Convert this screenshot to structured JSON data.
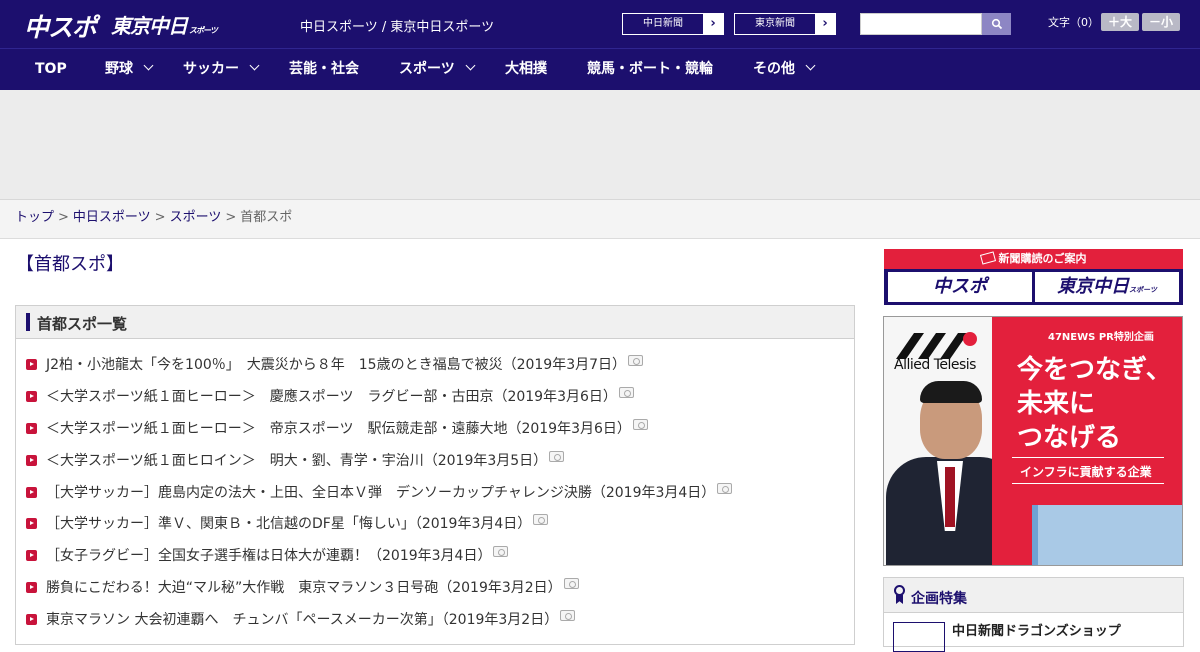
{
  "header": {
    "logo_chuspo": "中スポ",
    "logo_tokyo_main": "東京中日",
    "logo_tokyo_sub": "スポーツ",
    "site_names": "中日スポーツ / 東京中日スポーツ",
    "chunichi_link": "中日新聞",
    "tokyo_link": "東京新聞",
    "search_placeholder": "",
    "text_size_label": "文字（0）",
    "size_up": "＋大",
    "size_down": "－小"
  },
  "nav": [
    {
      "label": "TOP",
      "has_menu": false
    },
    {
      "label": "野球",
      "has_menu": true
    },
    {
      "label": "サッカー",
      "has_menu": true
    },
    {
      "label": "芸能・社会",
      "has_menu": false
    },
    {
      "label": "スポーツ",
      "has_menu": true
    },
    {
      "label": "大相撲",
      "has_menu": false
    },
    {
      "label": "競馬・ボート・競輪",
      "has_menu": false
    },
    {
      "label": "その他",
      "has_menu": true
    }
  ],
  "breadcrumb": {
    "items": [
      "トップ",
      "中日スポーツ",
      "スポーツ"
    ],
    "current": "首都スポ",
    "separator": ">"
  },
  "page_title": "【首都スポ】",
  "list": {
    "heading": "首都スポ一覧",
    "items": [
      "J2柏・小池龍太「今を100％」　大震災から８年　15歳のとき福島で被災（2019年3月7日）",
      "＜大学スポーツ紙１面ヒーロー＞　慶應スポーツ　ラグビー部・古田京（2019年3月6日）",
      "＜大学スポーツ紙１面ヒーロー＞　帝京スポーツ　駅伝競走部・遠藤大地（2019年3月6日）",
      "＜大学スポーツ紙１面ヒロイン＞　明大・劉、青学・宇治川（2019年3月5日）",
      "［大学サッカー］鹿島内定の法大・上田、全日本Ｖ弾　デンソーカップチャレンジ決勝（2019年3月4日）",
      "［大学サッカー］準Ｖ、関東Ｂ・北信越のDF星「悔しい」（2019年3月4日）",
      "［女子ラグビー］全国女子選手権は日体大が連覇！（2019年3月4日）",
      "勝負にこだわる！大迫“マル秘”大作戦　東京マラソン３日号砲（2019年3月2日）",
      "東京マラソン 大会初連覇へ　チュンバ「ペースメーカー次第」（2019年3月2日）"
    ]
  },
  "sidebar": {
    "subscribe_heading": "新聞購読のご案内",
    "subscribe_logo_1": "中スポ",
    "subscribe_logo_2_main": "東京中日",
    "subscribe_logo_2_sub": "スポーツ",
    "ad": {
      "brand": "Allied Telesis",
      "tag": "47NEWS PR特別企画",
      "lines": [
        "今をつなぎ、",
        "未来に",
        "つなげる"
      ],
      "subline": "インフラに貢献する企業",
      "accent_color": "#e3203c"
    },
    "feature_heading": "企画特集",
    "feature_item": "中日新聞ドラゴンズショップ"
  },
  "colors": {
    "brand_navy": "#1c0f6e",
    "accent_red": "#c8133b"
  }
}
